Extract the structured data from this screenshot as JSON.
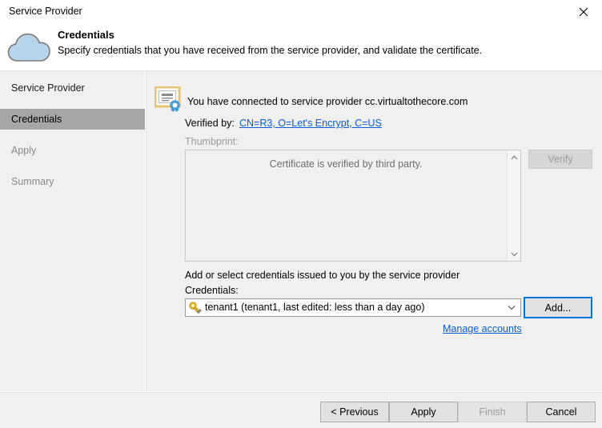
{
  "window": {
    "title": "Service Provider",
    "close_icon": "close-icon"
  },
  "header": {
    "icon": "cloud-icon",
    "title": "Credentials",
    "subtitle": "Specify credentials that you have received from the service provider, and validate the certificate."
  },
  "sidebar": {
    "items": [
      {
        "label": "Service Provider",
        "state": "normal"
      },
      {
        "label": "Credentials",
        "state": "selected"
      },
      {
        "label": "Apply",
        "state": "disabled"
      },
      {
        "label": "Summary",
        "state": "disabled"
      }
    ]
  },
  "main": {
    "cert_icon": "certificate-icon",
    "connected_text": "You have connected to service provider cc.virtualtothecore.com",
    "verified_by_label": "Verified by:",
    "verified_by_link": "CN=R3, O=Let's Encrypt, C=US",
    "thumbprint_label": "Thumbprint:",
    "thumbprint_text": "Certificate is verified by third party.",
    "verify_button": "Verify",
    "verify_button_enabled": false,
    "add_or_select_text": "Add or select credentials issued to you by the service provider",
    "credentials_label": "Credentials:",
    "credentials_value": "tenant1 (tenant1, last edited: less than a day ago)",
    "credentials_icon": "key-icon",
    "add_button": "Add...",
    "manage_accounts_link": "Manage accounts"
  },
  "footer": {
    "previous": "< Previous",
    "apply": "Apply",
    "finish": "Finish",
    "cancel": "Cancel"
  },
  "colors": {
    "window_bg": "#f0f0f0",
    "titlebar_bg": "#ffffff",
    "sidebar_selected_bg": "#a6a6a6",
    "link": "#0b5dd7",
    "focus_border": "#0078d7",
    "disabled_text": "#9a9a9a",
    "cloud_fill": "#b8d4ea",
    "cert_border": "#e8c473",
    "seal_blue": "#4a9ad4",
    "key_gold": "#f2c12e"
  }
}
